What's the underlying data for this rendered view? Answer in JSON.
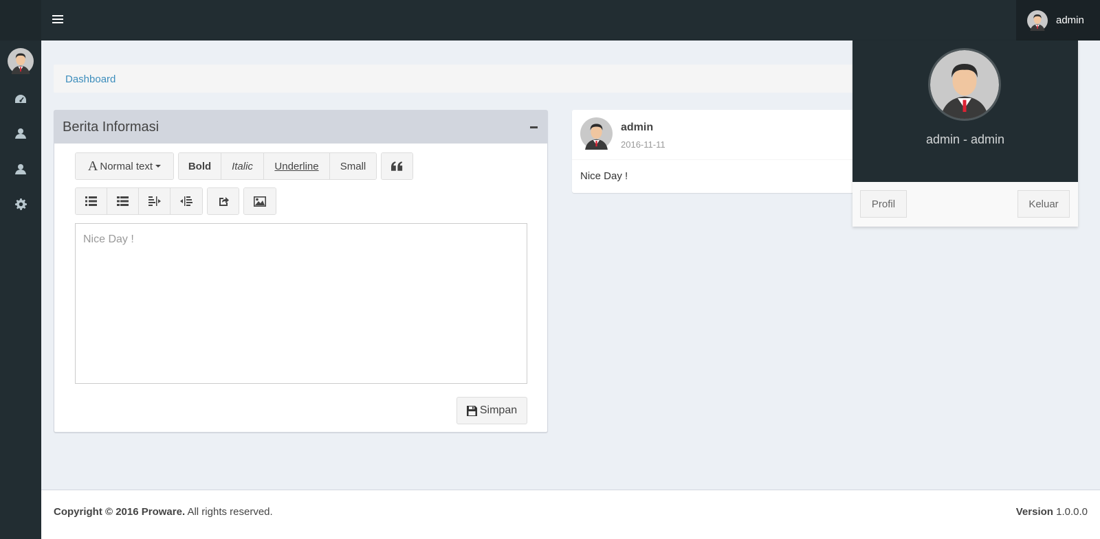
{
  "header": {
    "user_name": "admin",
    "avatar_icon": "user-avatar-icon",
    "menu_icon": "hamburger-menu-icon"
  },
  "sidebar": {
    "icons": [
      "dashboard-icon",
      "user-icon",
      "user-icon",
      "gear-icon"
    ]
  },
  "breadcrumb": {
    "label": "Dashboard"
  },
  "editor_box": {
    "title": "Berita Informasi",
    "toolbar": {
      "format_label": "Normal text",
      "bold_label": "Bold",
      "italic_label": "Italic",
      "underline_label": "Underline",
      "small_label": "Small",
      "quote_icon": "quote-icon",
      "list_icons": [
        "unordered-list-icon",
        "ordered-list-icon",
        "outdent-icon",
        "indent-icon"
      ],
      "link_icon": "share-icon",
      "image_icon": "image-icon"
    },
    "editor_placeholder": "Nice Day !",
    "save_label": "Simpan"
  },
  "post": {
    "user": "admin",
    "date": "2016-11-11",
    "content": "Nice Day !"
  },
  "user_dropdown": {
    "name": "admin - admin",
    "profile_label": "Profil",
    "logout_label": "Keluar"
  },
  "footer": {
    "copyright_bold": "Copyright © 2016 Proware.",
    "copyright_rest": "All rights reserved.",
    "version_label": "Version",
    "version_value": "1.0.0.0"
  },
  "colors": {
    "header_bg": "#222d32",
    "content_bg": "#ecf0f5",
    "link": "#3c8dbc",
    "box_header": "#d2d6de"
  }
}
